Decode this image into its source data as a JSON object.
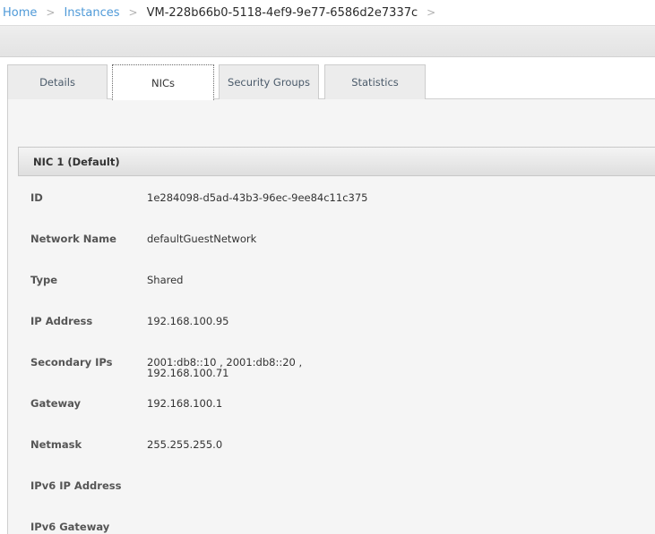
{
  "breadcrumb": {
    "home": "Home",
    "sep1": ">",
    "instances": "Instances",
    "sep2": ">",
    "current": "VM-228b66b0-5118-4ef9-9e77-6586d2e7337c",
    "sep3": ">"
  },
  "tabs": [
    {
      "label": "Details",
      "active": false
    },
    {
      "label": "NICs",
      "active": true
    },
    {
      "label": "Security Groups",
      "active": false
    },
    {
      "label": "Statistics",
      "active": false
    }
  ],
  "nic": {
    "title": "NIC 1 (Default)",
    "fields": [
      {
        "label": "ID",
        "value": "1e284098-d5ad-43b3-96ec-9ee84c11c375"
      },
      {
        "label": "Network Name",
        "value": "defaultGuestNetwork"
      },
      {
        "label": "Type",
        "value": "Shared"
      },
      {
        "label": "IP Address",
        "value": "192.168.100.95"
      },
      {
        "label": "Secondary IPs",
        "value": "2001:db8::10 , 2001:db8::20 ,\n192.168.100.71"
      },
      {
        "label": "Gateway",
        "value": "192.168.100.1"
      },
      {
        "label": "Netmask",
        "value": "255.255.255.0"
      },
      {
        "label": "IPv6 IP Address",
        "value": ""
      },
      {
        "label": "IPv6 Gateway",
        "value": ""
      }
    ]
  }
}
